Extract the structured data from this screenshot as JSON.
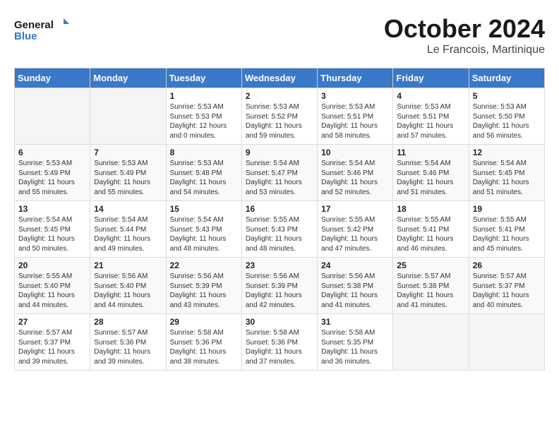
{
  "header": {
    "logo_line1": "General",
    "logo_line2": "Blue",
    "month": "October 2024",
    "location": "Le Francois, Martinique"
  },
  "weekdays": [
    "Sunday",
    "Monday",
    "Tuesday",
    "Wednesday",
    "Thursday",
    "Friday",
    "Saturday"
  ],
  "weeks": [
    [
      {
        "day": "",
        "text": ""
      },
      {
        "day": "",
        "text": ""
      },
      {
        "day": "1",
        "text": "Sunrise: 5:53 AM\nSunset: 5:53 PM\nDaylight: 12 hours\nand 0 minutes."
      },
      {
        "day": "2",
        "text": "Sunrise: 5:53 AM\nSunset: 5:52 PM\nDaylight: 11 hours\nand 59 minutes."
      },
      {
        "day": "3",
        "text": "Sunrise: 5:53 AM\nSunset: 5:51 PM\nDaylight: 11 hours\nand 58 minutes."
      },
      {
        "day": "4",
        "text": "Sunrise: 5:53 AM\nSunset: 5:51 PM\nDaylight: 11 hours\nand 57 minutes."
      },
      {
        "day": "5",
        "text": "Sunrise: 5:53 AM\nSunset: 5:50 PM\nDaylight: 11 hours\nand 56 minutes."
      }
    ],
    [
      {
        "day": "6",
        "text": "Sunrise: 5:53 AM\nSunset: 5:49 PM\nDaylight: 11 hours\nand 55 minutes."
      },
      {
        "day": "7",
        "text": "Sunrise: 5:53 AM\nSunset: 5:49 PM\nDaylight: 11 hours\nand 55 minutes."
      },
      {
        "day": "8",
        "text": "Sunrise: 5:53 AM\nSunset: 5:48 PM\nDaylight: 11 hours\nand 54 minutes."
      },
      {
        "day": "9",
        "text": "Sunrise: 5:54 AM\nSunset: 5:47 PM\nDaylight: 11 hours\nand 53 minutes."
      },
      {
        "day": "10",
        "text": "Sunrise: 5:54 AM\nSunset: 5:46 PM\nDaylight: 11 hours\nand 52 minutes."
      },
      {
        "day": "11",
        "text": "Sunrise: 5:54 AM\nSunset: 5:46 PM\nDaylight: 11 hours\nand 51 minutes."
      },
      {
        "day": "12",
        "text": "Sunrise: 5:54 AM\nSunset: 5:45 PM\nDaylight: 11 hours\nand 51 minutes."
      }
    ],
    [
      {
        "day": "13",
        "text": "Sunrise: 5:54 AM\nSunset: 5:45 PM\nDaylight: 11 hours\nand 50 minutes."
      },
      {
        "day": "14",
        "text": "Sunrise: 5:54 AM\nSunset: 5:44 PM\nDaylight: 11 hours\nand 49 minutes."
      },
      {
        "day": "15",
        "text": "Sunrise: 5:54 AM\nSunset: 5:43 PM\nDaylight: 11 hours\nand 48 minutes."
      },
      {
        "day": "16",
        "text": "Sunrise: 5:55 AM\nSunset: 5:43 PM\nDaylight: 11 hours\nand 48 minutes."
      },
      {
        "day": "17",
        "text": "Sunrise: 5:55 AM\nSunset: 5:42 PM\nDaylight: 11 hours\nand 47 minutes."
      },
      {
        "day": "18",
        "text": "Sunrise: 5:55 AM\nSunset: 5:41 PM\nDaylight: 11 hours\nand 46 minutes."
      },
      {
        "day": "19",
        "text": "Sunrise: 5:55 AM\nSunset: 5:41 PM\nDaylight: 11 hours\nand 45 minutes."
      }
    ],
    [
      {
        "day": "20",
        "text": "Sunrise: 5:55 AM\nSunset: 5:40 PM\nDaylight: 11 hours\nand 44 minutes."
      },
      {
        "day": "21",
        "text": "Sunrise: 5:56 AM\nSunset: 5:40 PM\nDaylight: 11 hours\nand 44 minutes."
      },
      {
        "day": "22",
        "text": "Sunrise: 5:56 AM\nSunset: 5:39 PM\nDaylight: 11 hours\nand 43 minutes."
      },
      {
        "day": "23",
        "text": "Sunrise: 5:56 AM\nSunset: 5:39 PM\nDaylight: 11 hours\nand 42 minutes."
      },
      {
        "day": "24",
        "text": "Sunrise: 5:56 AM\nSunset: 5:38 PM\nDaylight: 11 hours\nand 41 minutes."
      },
      {
        "day": "25",
        "text": "Sunrise: 5:57 AM\nSunset: 5:38 PM\nDaylight: 11 hours\nand 41 minutes."
      },
      {
        "day": "26",
        "text": "Sunrise: 5:57 AM\nSunset: 5:37 PM\nDaylight: 11 hours\nand 40 minutes."
      }
    ],
    [
      {
        "day": "27",
        "text": "Sunrise: 5:57 AM\nSunset: 5:37 PM\nDaylight: 11 hours\nand 39 minutes."
      },
      {
        "day": "28",
        "text": "Sunrise: 5:57 AM\nSunset: 5:36 PM\nDaylight: 11 hours\nand 39 minutes."
      },
      {
        "day": "29",
        "text": "Sunrise: 5:58 AM\nSunset: 5:36 PM\nDaylight: 11 hours\nand 38 minutes."
      },
      {
        "day": "30",
        "text": "Sunrise: 5:58 AM\nSunset: 5:36 PM\nDaylight: 11 hours\nand 37 minutes."
      },
      {
        "day": "31",
        "text": "Sunrise: 5:58 AM\nSunset: 5:35 PM\nDaylight: 11 hours\nand 36 minutes."
      },
      {
        "day": "",
        "text": ""
      },
      {
        "day": "",
        "text": ""
      }
    ]
  ]
}
